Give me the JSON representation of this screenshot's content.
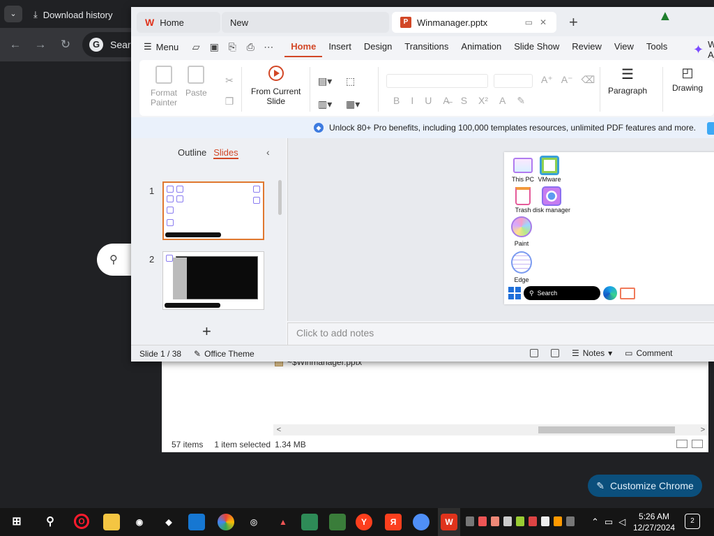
{
  "chrome": {
    "tab_title": "Download history",
    "search_prefix": "Searc",
    "customize_label": "Customize Chrome"
  },
  "explorer": {
    "file_name": "~$Winmanager.pptx",
    "item_count": "57 items",
    "selected": "1 item selected",
    "size": "1.34 MB"
  },
  "wps": {
    "tabs": {
      "home": "Home",
      "new": "New",
      "doc": "Winmanager.pptx"
    },
    "ai_label": "WPS AI",
    "menu_label": "Menu",
    "menu_items": [
      "Home",
      "Insert",
      "Design",
      "Transitions",
      "Animation",
      "Slide Show",
      "Review",
      "View",
      "Tools"
    ],
    "ribbon": {
      "format_painter_1": "Format",
      "format_painter_2": "Painter",
      "paste": "Paste",
      "from_current_1": "From Current",
      "from_current_2": "Slide",
      "paragraph": "Paragraph",
      "drawing": "Drawing"
    },
    "promo_text": "Unlock 80+ Pro benefits, including 100,000 templates resources, unlimited PDF features and more.",
    "pane_tabs": {
      "outline": "Outline",
      "slides": "Slides"
    },
    "slide_numbers": [
      "1",
      "2"
    ],
    "slide": {
      "icons": {
        "this_pc": "This PC",
        "vmware": "VMware",
        "trash": "Trash",
        "disk": "disk manager",
        "paint": "Paint",
        "edge": "Edge"
      },
      "search": "Search"
    },
    "notes_placeholder": "Click to add notes",
    "status": {
      "slide_count": "Slide 1 / 38",
      "theme": "Office Theme",
      "notes": "Notes",
      "comment": "Comment"
    }
  },
  "taskbar": {
    "time": "5:26 AM",
    "date": "12/27/2024",
    "notifications": "2"
  }
}
